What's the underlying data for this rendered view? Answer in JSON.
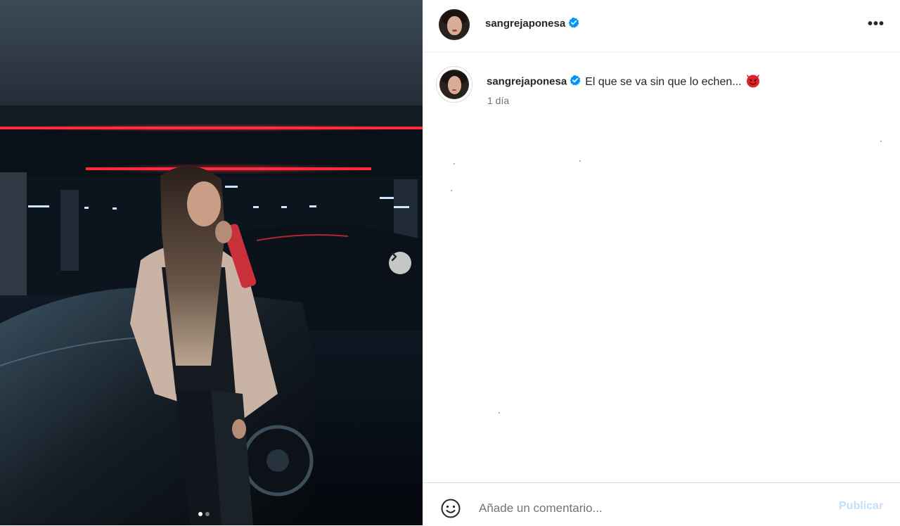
{
  "post": {
    "username": "sangrejaponesa",
    "verified": true,
    "caption": "El que se va sin que lo echen...",
    "caption_emoji_icon": "smiling-devil-icon",
    "time_ago": "1 día",
    "carousel": {
      "current_slide": 1,
      "total_slides": 2
    }
  },
  "header": {
    "username": "sangrejaponesa",
    "more_icon": "more-options-icon",
    "more_label": "•••"
  },
  "comment_box": {
    "placeholder": "Añade un comentario...",
    "value": "",
    "publish_label": "Publicar",
    "emoji_icon": "emoji-smiley-icon"
  },
  "colors": {
    "verified_blue": "#0095f6",
    "publish_disabled": "#c2e0fd",
    "neon_red": "#ff2a3a",
    "photo_dark": "#0a0f16"
  }
}
